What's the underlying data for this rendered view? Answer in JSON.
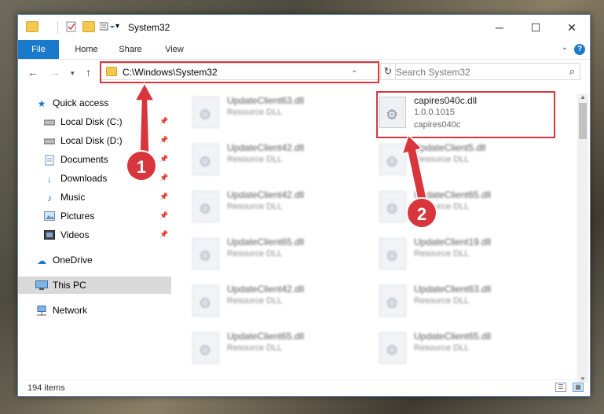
{
  "window": {
    "title": "System32",
    "controls": {
      "minimize": "─",
      "maximize": "☐",
      "close": "✕"
    }
  },
  "ribbon": {
    "tabs": [
      "File",
      "Home",
      "Share",
      "View"
    ],
    "help": "?"
  },
  "navbar": {
    "address": "C:\\Windows\\System32",
    "search_placeholder": "Search System32"
  },
  "sidebar": {
    "items": [
      {
        "label": "Quick access",
        "icon": "star-icon",
        "pinned": false
      },
      {
        "label": "Local Disk (C:)",
        "icon": "drive-icon",
        "pinned": true
      },
      {
        "label": "Local Disk (D:)",
        "icon": "drive-icon",
        "pinned": true
      },
      {
        "label": "Documents",
        "icon": "documents-icon",
        "pinned": true
      },
      {
        "label": "Downloads",
        "icon": "download-icon",
        "pinned": true
      },
      {
        "label": "Music",
        "icon": "music-icon",
        "pinned": true
      },
      {
        "label": "Pictures",
        "icon": "pictures-icon",
        "pinned": true
      },
      {
        "label": "Videos",
        "icon": "videos-icon",
        "pinned": true
      },
      {
        "label": "OneDrive",
        "icon": "cloud-icon",
        "pinned": false
      },
      {
        "label": "This PC",
        "icon": "computer-icon",
        "pinned": false,
        "selected": true
      },
      {
        "label": "Network",
        "icon": "network-icon",
        "pinned": false
      }
    ]
  },
  "files": {
    "left": [
      {
        "name": "UpdateClient63.dll",
        "desc": "Resource DLL"
      },
      {
        "name": "UpdateClient42.dll",
        "desc": "Resource DLL"
      },
      {
        "name": "UpdateClient42.dll",
        "desc": "Resource DLL"
      },
      {
        "name": "UpdateClient65.dll",
        "desc": "Resource DLL"
      },
      {
        "name": "UpdateClient42.dll",
        "desc": "Resource DLL"
      },
      {
        "name": "UpdateClient65.dll",
        "desc": "Resource DLL"
      }
    ],
    "highlighted": {
      "name": "capires040c.dll",
      "version": "1.0.0.1015",
      "product": "capires040c"
    },
    "right": [
      {
        "name": "UpdateClient5.dll",
        "desc": "Resource DLL"
      },
      {
        "name": "UpdateClient65.dll",
        "desc": "Resource DLL"
      },
      {
        "name": "UpdateClient19.dll",
        "desc": "Resource DLL"
      },
      {
        "name": "UpdateClient63.dll",
        "desc": "Resource DLL"
      },
      {
        "name": "UpdateClient65.dll",
        "desc": "Resource DLL"
      }
    ]
  },
  "status": {
    "count": "194 items"
  },
  "annotations": {
    "step1": "1",
    "step2": "2",
    "color": "#d9353d"
  }
}
